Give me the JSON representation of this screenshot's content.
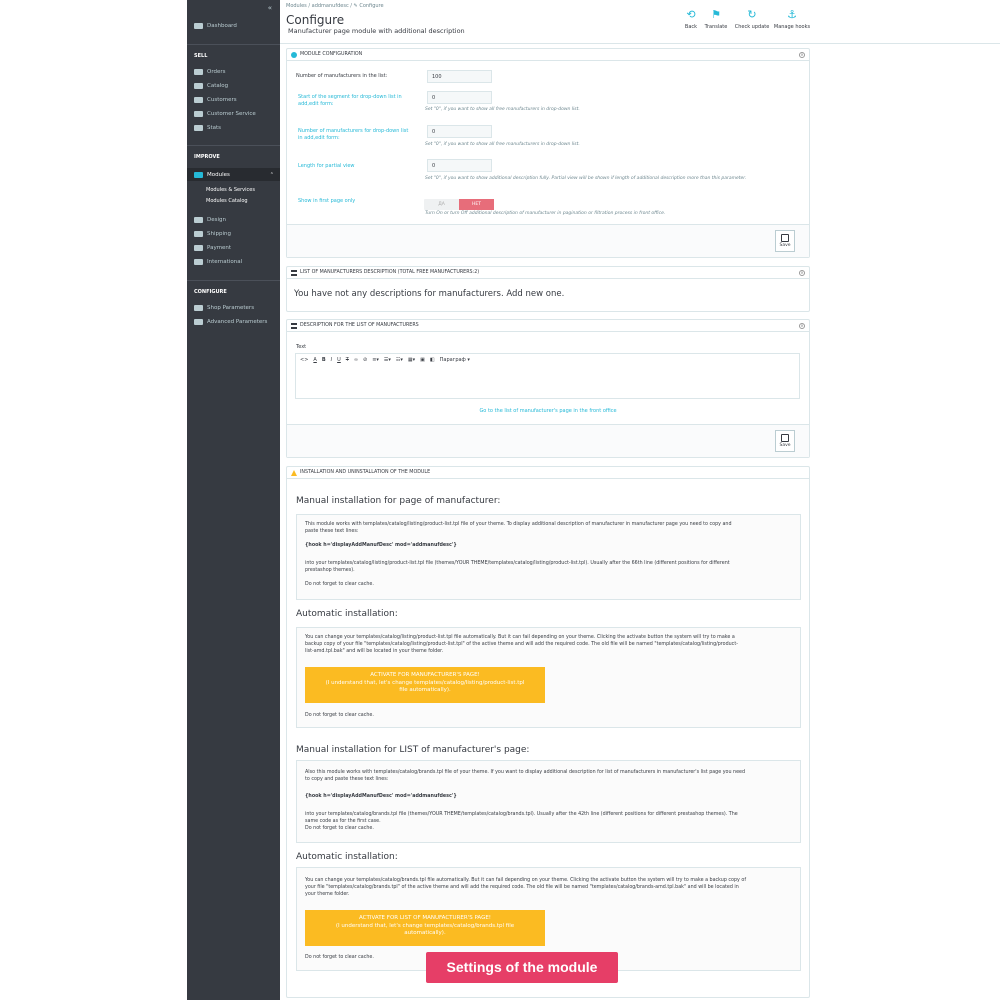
{
  "sidebar": {
    "collapse": "«",
    "dashboard": "Dashboard",
    "sec_sell": "SELL",
    "sell_items": [
      "Orders",
      "Catalog",
      "Customers",
      "Customer Service",
      "Stats"
    ],
    "sec_improve": "IMPROVE",
    "modules": "Modules",
    "modules_sub": [
      "Modules & Services",
      "Modules Catalog"
    ],
    "improve_items": [
      "Design",
      "Shipping",
      "Payment",
      "International"
    ],
    "sec_configure": "CONFIGURE",
    "configure_items": [
      "Shop Parameters",
      "Advanced Parameters"
    ]
  },
  "header": {
    "breadcrumb": "Modules  /  addmanufdesc  /   ✎ Configure",
    "title": "Configure",
    "subtitle": "Manufacturer page module with additional description",
    "toolbar": [
      {
        "label": "Back",
        "icon": "back-icon"
      },
      {
        "label": "Translate",
        "icon": "flag-icon"
      },
      {
        "label": "Check update",
        "icon": "refresh-icon"
      },
      {
        "label": "Manage hooks",
        "icon": "anchor-icon"
      }
    ]
  },
  "config_panel": {
    "heading": "MODULE CONFIGURATION",
    "f1_label": "Number of manufacturers in the list:",
    "f1_value": "100",
    "f2_label": "Start of the segment for drop-down list in add,edit form:",
    "f2_value": "0",
    "f2_help": "Set \"0\", if you want to show all free manufacturers in drop-down list.",
    "f3_label": "Number of manufacturers for drop-down list in add,edit form:",
    "f3_value": "0",
    "f3_help": "Set \"0\", if you want to show all free manufacturers in drop-down list.",
    "f4_label": "Length for partial view",
    "f4_value": "0",
    "f4_help": "Set \"0\", if you want to show additional description fully. Partial view will be shown if length of additional description more than this parameter.",
    "f5_label": "Show in first page only",
    "f5_on": "ДА",
    "f5_off": "НЕТ",
    "f5_help": "Turn On or turn Off additional description of manufacturer in pagination or filtration process in front office.",
    "save": "Save"
  },
  "list_panel": {
    "heading": "LIST OF MANUFACTURERS DESCRIPTION (TOTAL FREE MANUFACTURERS:2)",
    "empty": "You have not any descriptions for manufacturers. Add new one."
  },
  "desc_panel": {
    "heading": "DESCRIPTION FOR THE LIST OF MANUFACTURERS",
    "text_label": "Text",
    "paragraph": "Параграф",
    "link": "Go to the list of manufacturer's page in the front office",
    "save": "Save"
  },
  "install_panel": {
    "heading": "INSTALLATION AND UNINSTALLATION OF THE MODULE",
    "s1_title": "Manual installation for page of manufacturer:",
    "s1_p1": "This module works with templates/catalog/listing/product-list.tpl file of your theme. To display additional description of manufacturer in manufacturer page you need to copy and",
    "s1_p1b": "paste these text lines:",
    "s1_code": "{hook h='displayAddManufDesc' mod='addmanufdesc'}",
    "s1_p2": "into your templates/catalog/listing/product-list.tpl file (themes/YOUR THEME/templates/catalog/listing/product-list.tpl). Usually after the 66th line (different positions for different",
    "s1_p2b": "prestashop themes).",
    "s1_p3": "Do not forget to clear cache.",
    "s2_title": "Automatic installation:",
    "s2_p1": "You can change your templates/catalog/listing/product-list.tpl file automatically. But it can fail depending on your theme. Clicking the activate button the system will try to make a",
    "s2_p1b": "backup copy of your file \"templates/catalog/listing/product-list.tpl\" of the active theme and will add the required code. The old file will be named \"templates/catalog/listing/product-",
    "s2_p1c": "list-amd.tpl.bak\" and will be located in your theme folder.",
    "s2_btn1": "ACTIVATE FOR MANUFACTURER'S PAGE!",
    "s2_btn2": "(I understand that, let's change templates/catalog/listing/product-list.tpl",
    "s2_btn3": "file automatically).",
    "s2_p2": "Do not forget to clear cache.",
    "s3_title": "Manual installation for LIST of manufacturer's page:",
    "s3_p1": "Also this module works with templates/catalog/brands.tpl file of your theme. If you want to display additional description for list of manufacturers in manufacturer's list page you need",
    "s3_p1b": "to copy and paste these text lines:",
    "s3_code": "{hook h='displayAddManufDesc' mod='addmanufdesc'}",
    "s3_p2": "into your templates/catalog/brands.tpl file (themes/YOUR THEME/templates/catalog/brands.tpl). Usually after the 42th line (different positions for different prestashop themes). The",
    "s3_p2b": "same code as for the first case.",
    "s3_p3": "Do not forget to clear cache.",
    "s4_title": "Automatic installation:",
    "s4_p1": "You can change your templates/catalog/brands.tpl file automatically. But it can fail depending on your theme. Clicking the activate button the system will try to make a backup copy of",
    "s4_p1b": "your file \"templates/catalog/brands.tpl\" of the active theme and will add the required code. The old file will be named \"templates/catalog/brands-amd.tpl.bak\" and will be located in",
    "s4_p1c": "your theme folder.",
    "s4_btn1": "ACTIVATE FOR LIST OF MANUFACTURER'S PAGE!",
    "s4_btn2": "(I understand that, let's change templates/catalog/brands.tpl file",
    "s4_btn3": "automatically).",
    "s4_p2": "Do not forget to clear cache."
  },
  "banner": "Settings of the module"
}
